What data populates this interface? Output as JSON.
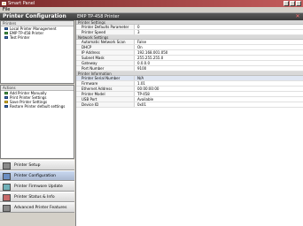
{
  "window": {
    "title": "Smart Panel"
  },
  "menubar": {
    "file": "File"
  },
  "left_header": "Printer Configuration",
  "right_header": "EMP TP-458 Printer",
  "printers_panel": {
    "title": "Printers",
    "items": [
      {
        "label": "Local Printer Management",
        "icon": "printer-icon"
      },
      {
        "label": "EMP TP-458 Printer",
        "icon": "printer-icon"
      },
      {
        "label": "Test Printer",
        "icon": "printer-icon"
      }
    ]
  },
  "actions_panel": {
    "title": "Actions",
    "items": [
      {
        "label": "Add Printer Manually",
        "icon": "add-icon"
      },
      {
        "label": "Print Printer Settings",
        "icon": "print-icon"
      },
      {
        "label": "Save Printer Settings",
        "icon": "save-icon"
      },
      {
        "label": "Restore Printer default settings",
        "icon": "restore-icon"
      }
    ]
  },
  "nav": [
    {
      "label": "Printer Setup",
      "icon": "gray"
    },
    {
      "label": "Printer Configuration",
      "icon": "blue"
    },
    {
      "label": "Printer Firmware Update",
      "icon": "teal"
    },
    {
      "label": "Printer Status & Info",
      "icon": "red"
    },
    {
      "label": "Advanced Printer Features",
      "icon": "gray"
    }
  ],
  "properties": [
    {
      "category": "Printer Settings",
      "rows": [
        {
          "key": "Printer Defaults Parameter",
          "value": "0"
        },
        {
          "key": "Printer Speed",
          "value": "3"
        }
      ]
    },
    {
      "category": "Network Settings",
      "rows": [
        {
          "key": "Automatic Network Scan",
          "value": "False"
        },
        {
          "key": "DHCP",
          "value": "On"
        },
        {
          "key": "IP Address",
          "value": "192.168.001.050"
        },
        {
          "key": "Subnet Mask",
          "value": "255.255.255.0"
        },
        {
          "key": "Gateway",
          "value": "0.0.0.0"
        },
        {
          "key": "Port Number",
          "value": "9100"
        }
      ]
    },
    {
      "category": "Printer Information",
      "rows": [
        {
          "key": "Printer Serial Number",
          "value": "N/A",
          "selected": true
        },
        {
          "key": "Firmware",
          "value": "1.01"
        },
        {
          "key": "Ethernet Address",
          "value": "00:00:00:00"
        },
        {
          "key": "Printer Model",
          "value": "TP-458"
        },
        {
          "key": "USB Port",
          "value": "Available"
        },
        {
          "key": "Device ID",
          "value": "0x01"
        }
      ]
    }
  ]
}
